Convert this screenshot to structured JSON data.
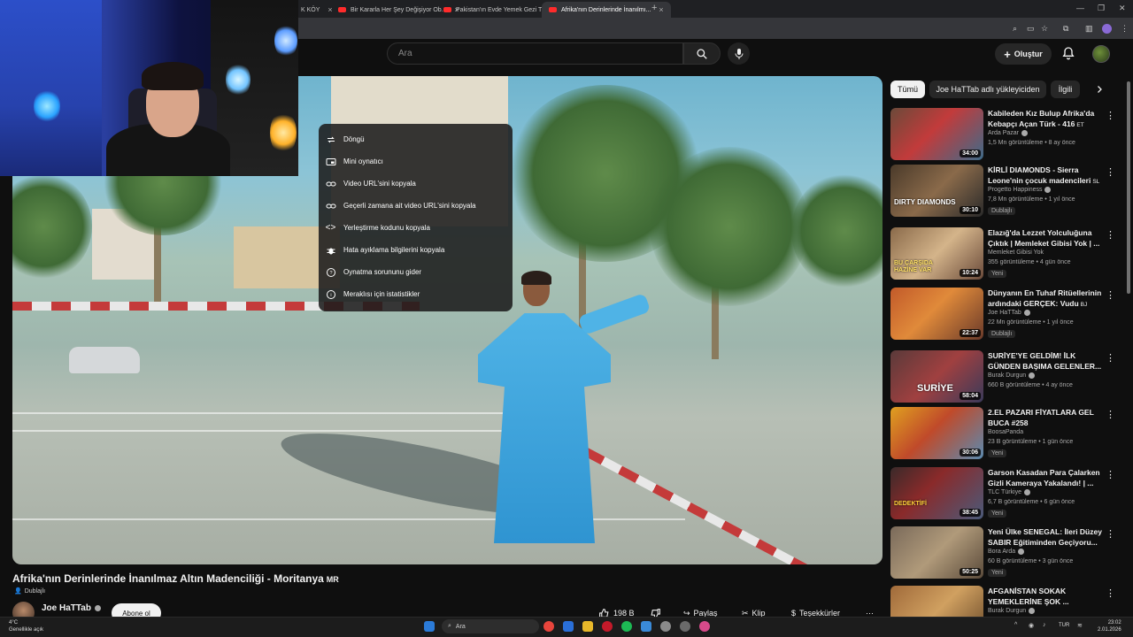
{
  "browser": {
    "tabs": [
      {
        "label": "K KÖY"
      },
      {
        "label": "Bir Kararla Her Şey Değişiyor Ob..."
      },
      {
        "label": "Pakistan'ın Evde Yemek Gezi Tu..."
      },
      {
        "label": "Afrika'nın Derinlerinde İnanılmı..."
      }
    ],
    "new_tab": "+"
  },
  "header": {
    "search_placeholder": "Ara",
    "create_label": "Oluştur"
  },
  "context_menu": {
    "items": [
      {
        "label": "Döngü",
        "icon": "loop-icon"
      },
      {
        "label": "Mini oynatıcı",
        "icon": "miniplayer-icon"
      },
      {
        "label": "Video URL'sini kopyala",
        "icon": "link-icon"
      },
      {
        "label": "Geçerli zamana ait video URL'sini kopyala",
        "icon": "link-icon"
      },
      {
        "label": "Yerleştirme kodunu kopyala",
        "icon": "embed-icon"
      },
      {
        "label": "Hata ayıklama bilgilerini kopyala",
        "icon": "bug-icon"
      },
      {
        "label": "Oynatma sorununu gider",
        "icon": "help-icon"
      },
      {
        "label": "Meraklısı için istatistikler",
        "icon": "info-icon"
      }
    ]
  },
  "video": {
    "title": "Afrika'nın Derinlerinde İnanılmaz Altın Madenciliği - Moritanya",
    "title_tag": "MR",
    "dubbed": "Dublajlı",
    "channel": "Joe HaTTab",
    "subscribe": "Abone ol",
    "likes": "198 B",
    "share": "Paylaş",
    "clip": "Klip",
    "thanks": "Teşekkürler",
    "more": "⋯"
  },
  "sidebar": {
    "chips": [
      "Tümü",
      "Joe HaTTab adlı yükleyiciden",
      "İlgili"
    ],
    "videos": [
      {
        "title": "Kabileden Kız Bulup Afrika'da Kebapçı Açan Türk - 416",
        "tag": "ET",
        "channel": "Arda Pazar",
        "meta": "1,5 Mn görüntüleme • 8 ay önce",
        "duration": "34:00",
        "badge": "",
        "thumb_text": ""
      },
      {
        "title": "KİRLİ DIAMONDS - Sierra Leone'nin çocuk madencileri",
        "tag": "SL",
        "channel": "Progetto Happiness",
        "meta": "7,8 Mn görüntüleme • 1 yıl önce",
        "duration": "30:10",
        "badge": "Dublajlı",
        "thumb_text": "DIRTY DIAMONDS"
      },
      {
        "title": "Elazığ'da Lezzet Yolculuğuna Çıktık | Memleket Gibisi Yok | ...",
        "tag": "",
        "channel": "Memleket Gibisi Yok",
        "meta": "355 görüntüleme • 4 gün önce",
        "duration": "10:24",
        "badge": "Yeni",
        "thumb_text": "BU ÇARŞIDA HAZİNE VAR"
      },
      {
        "title": "Dünyanın En Tuhaf Ritüellerinin ardındaki GERÇEK: Vudu",
        "tag": "BJ",
        "channel": "Joe HaTTab",
        "meta": "22 Mn görüntüleme • 1 yıl önce",
        "duration": "22:37",
        "badge": "Dublajlı",
        "thumb_text": ""
      },
      {
        "title": "SURİYE'YE GELDİM! İLK GÜNDEN BAŞIMA GELENLER...",
        "tag": "",
        "channel": "Burak Durgun",
        "meta": "660 B görüntüleme • 4 ay önce",
        "duration": "58:04",
        "badge": "",
        "thumb_text": "SURİYE"
      },
      {
        "title": "2.EL PAZARI FİYATLARA GEL BUCA #258",
        "tag": "",
        "channel": "BoosaPanda",
        "meta": "23 B görüntüleme • 1 gün önce",
        "duration": "30:06",
        "badge": "Yeni",
        "thumb_text": ""
      },
      {
        "title": "Garson Kasadan Para Çalarken Gizli Kameraya Yakalandı! | ...",
        "tag": "",
        "channel": "TLC Türkiye",
        "meta": "6,7 B görüntüleme • 6 gün önce",
        "duration": "38:45",
        "badge": "Yeni",
        "thumb_text": "DEDEKTİFİ"
      },
      {
        "title": "Yeni Ülke SENEGAL: İleri Düzey SABIR Eğitiminden Geçiyoru...",
        "tag": "",
        "channel": "Bora Arda",
        "meta": "60 B görüntüleme • 3 gün önce",
        "duration": "50:25",
        "badge": "Yeni",
        "thumb_text": ""
      },
      {
        "title": "AFGANİSTAN SOKAK YEMEKLERİNE ŞOK ...",
        "tag": "",
        "channel": "Burak Durgun",
        "meta": "",
        "duration": "",
        "badge": "",
        "thumb_text": ""
      }
    ]
  },
  "taskbar": {
    "weather_temp": "4°C",
    "weather_desc": "Genellikle açık",
    "search": "Ara",
    "lang": "TUR",
    "time": "23:02",
    "date": "2.01.2026"
  },
  "colors": {
    "background": "#0f0f0f",
    "accent_red": "#ff0000",
    "menu_bg": "#1c1c1c"
  }
}
